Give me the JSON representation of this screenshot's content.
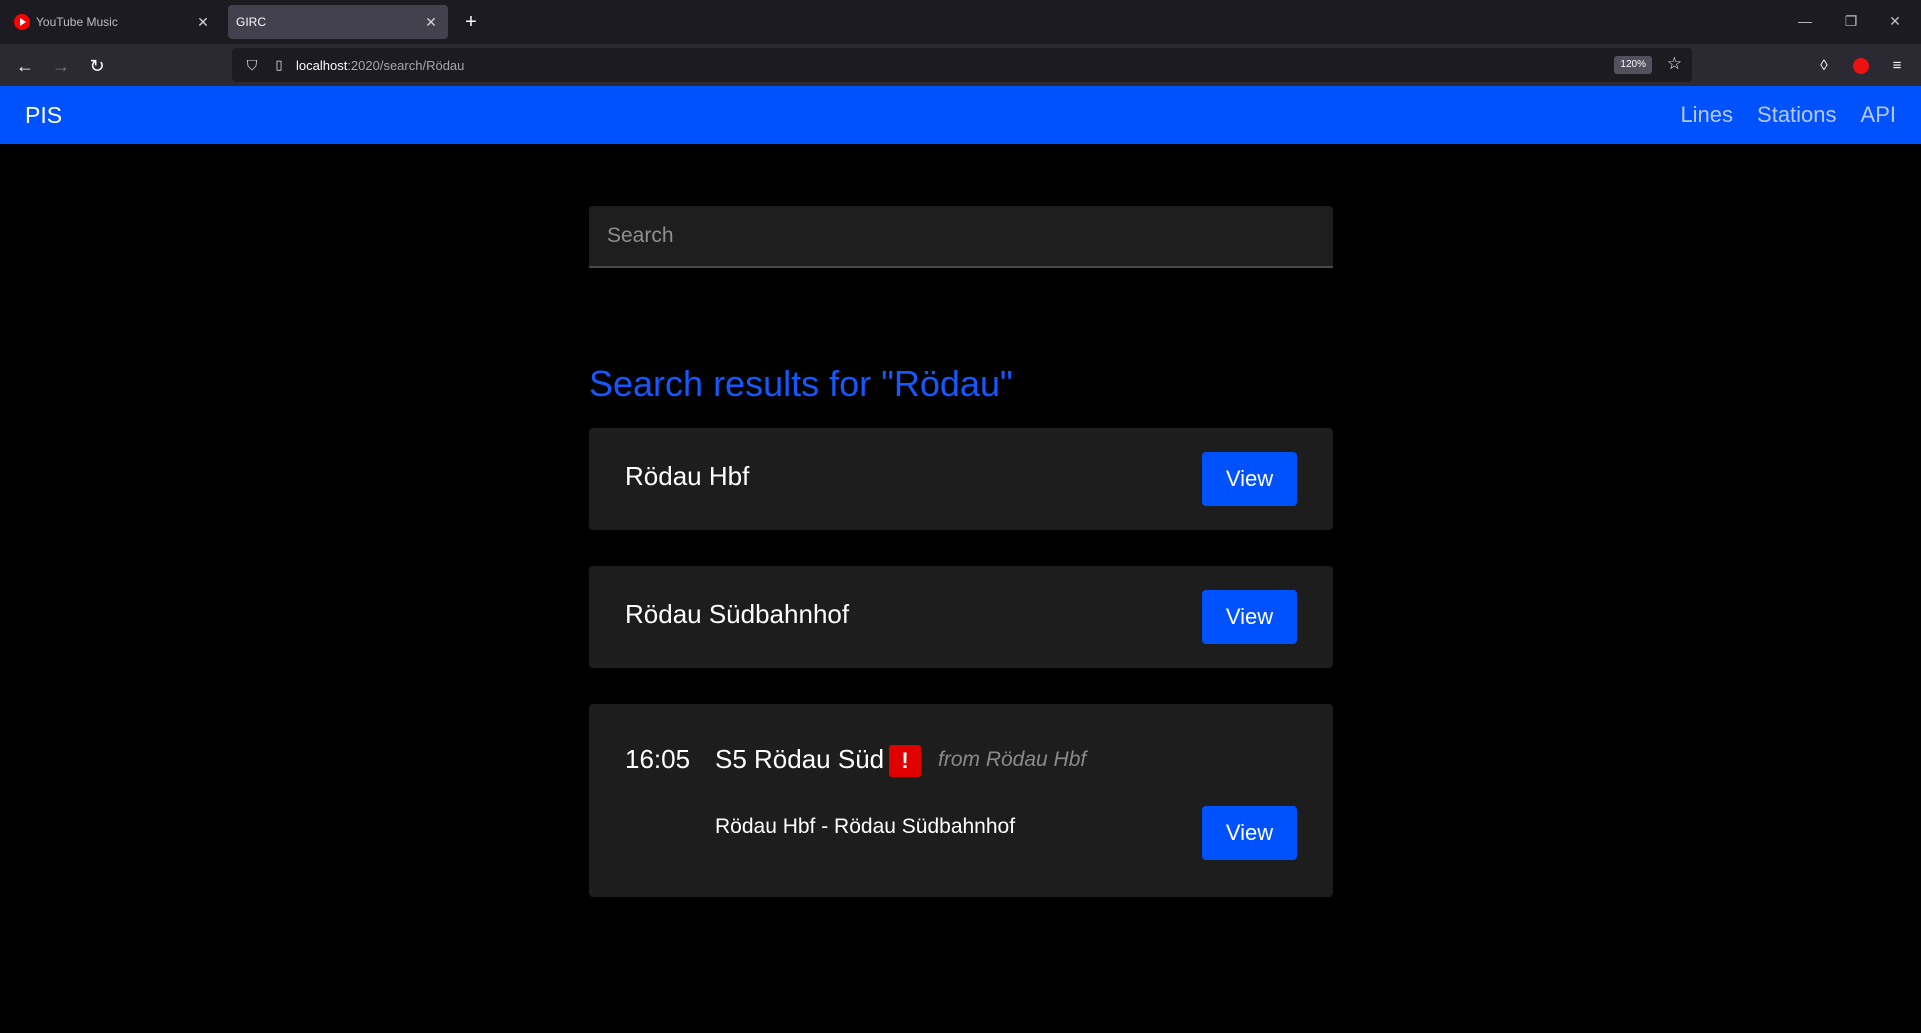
{
  "browser": {
    "tabs": [
      {
        "title": "YouTube Music",
        "active": false,
        "icon": "youtube-music-icon"
      },
      {
        "title": "GIRC",
        "active": true
      }
    ],
    "url_host": "localhost",
    "url_path": ":2020/search/Rödau",
    "zoom": "120%"
  },
  "site": {
    "brand": "PIS",
    "nav_links": [
      "Lines",
      "Stations",
      "API"
    ]
  },
  "search": {
    "placeholder": "Search",
    "value": ""
  },
  "results": {
    "title": "Search results for \"Rödau\"",
    "stations": [
      {
        "name": "Rödau Hbf",
        "button": "View"
      },
      {
        "name": "Rödau Südbahnhof",
        "button": "View"
      }
    ],
    "trip": {
      "time": "16:05",
      "line": "S5 Rödau Süd",
      "alert": "!",
      "from": "from Rödau Hbf",
      "route": "Rödau Hbf - Rödau Südbahnhof",
      "button": "View"
    }
  },
  "colors": {
    "navbar": "#0052ff",
    "accent": "#1558ff",
    "alert": "#e00000",
    "card": "#1d1d1d"
  }
}
